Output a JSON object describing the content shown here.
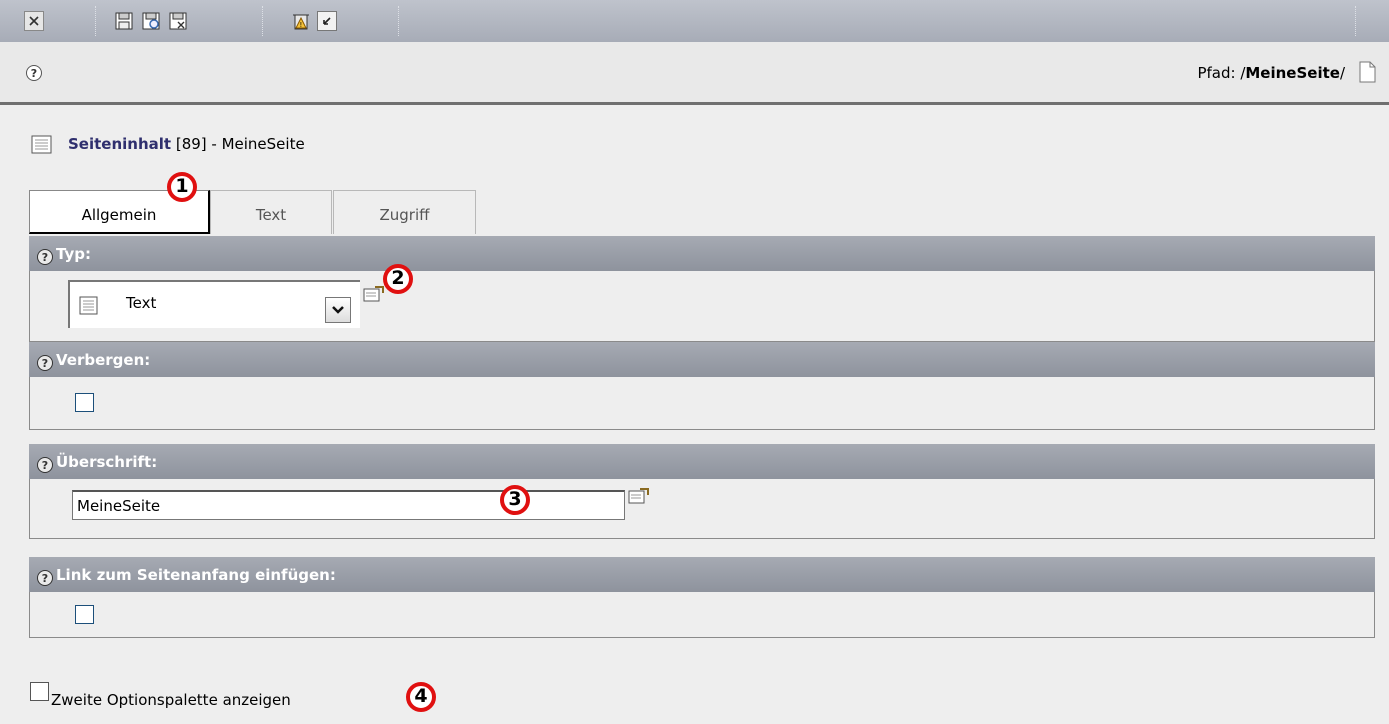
{
  "toolbar": {
    "icons": [
      "close-icon",
      "save-icon",
      "save-view-icon",
      "save-close-icon",
      "delete-icon",
      "undo-icon"
    ]
  },
  "header": {
    "path_label": "Pfad: /",
    "path_value": "MeineSeite",
    "path_suffix": "/"
  },
  "record": {
    "title_link": "Seiteninhalt",
    "title_rest": " [89] - MeineSeite"
  },
  "tabs": [
    {
      "label": "Allgemein",
      "active": true
    },
    {
      "label": "Text",
      "active": false
    },
    {
      "label": "Zugriff",
      "active": false
    }
  ],
  "fields": {
    "typ": {
      "label": "Typ:",
      "value": "Text"
    },
    "verbergen": {
      "label": "Verbergen:",
      "checked": false
    },
    "ueberschrift": {
      "label": "Überschrift:",
      "value": "MeineSeite"
    },
    "link_top": {
      "label": "Link zum Seitenanfang einfügen:",
      "checked": false
    }
  },
  "second_palette": {
    "label": "Zweite Optionspalette anzeigen",
    "checked": false
  },
  "markers": [
    "1",
    "2",
    "3",
    "4"
  ],
  "colors": {
    "accent": "#2f2f6e",
    "marker": "#e01010",
    "section_head": "#9a9ea8"
  }
}
